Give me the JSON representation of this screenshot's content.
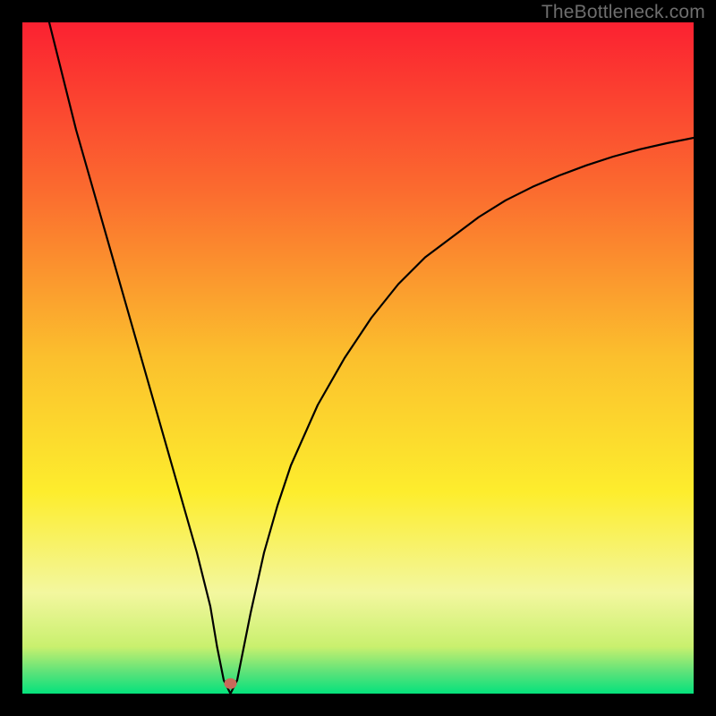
{
  "watermark": "TheBottleneck.com",
  "chart_data": {
    "type": "line",
    "title": "",
    "xlabel": "",
    "ylabel": "",
    "xlim": [
      0,
      100
    ],
    "ylim": [
      0,
      100
    ],
    "grid": false,
    "legend": false,
    "gradient_stops": [
      {
        "offset": 0.0,
        "color": "#fb2131"
      },
      {
        "offset": 0.25,
        "color": "#fb6b2f"
      },
      {
        "offset": 0.5,
        "color": "#fbc02d"
      },
      {
        "offset": 0.7,
        "color": "#fded2d"
      },
      {
        "offset": 0.85,
        "color": "#f3f79f"
      },
      {
        "offset": 0.93,
        "color": "#c9f06e"
      },
      {
        "offset": 0.97,
        "color": "#57e27a"
      },
      {
        "offset": 1.0,
        "color": "#05e27c"
      }
    ],
    "marker": {
      "x": 31,
      "y": 1.5,
      "color": "#c96a5a",
      "r": 1.0
    },
    "series": [
      {
        "name": "curve",
        "x": [
          4,
          6,
          8,
          10,
          12,
          14,
          16,
          18,
          20,
          22,
          24,
          26,
          28,
          29,
          30,
          31,
          32,
          34,
          36,
          38,
          40,
          44,
          48,
          52,
          56,
          60,
          64,
          68,
          72,
          76,
          80,
          84,
          88,
          92,
          96,
          100
        ],
        "values": [
          100,
          92,
          84,
          77,
          70,
          63,
          56,
          49,
          42,
          35,
          28,
          21,
          13,
          7,
          2,
          0,
          2,
          12,
          21,
          28,
          34,
          43,
          50,
          56,
          61,
          65,
          68,
          71,
          73.5,
          75.5,
          77.2,
          78.7,
          80,
          81.1,
          82,
          82.8
        ]
      }
    ]
  }
}
